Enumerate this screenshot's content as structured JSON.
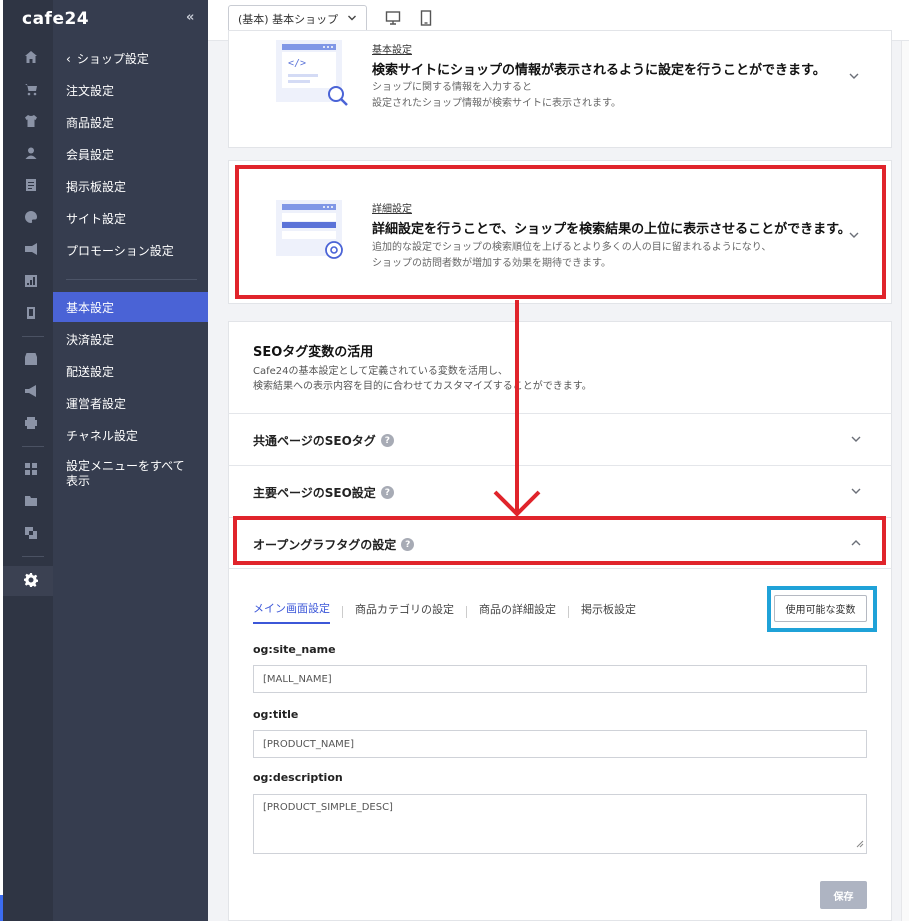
{
  "brand": {
    "logo": "cafe24",
    "collapse_glyph": "«"
  },
  "rail_icons": [
    "home-icon",
    "cart-icon",
    "shirt-icon",
    "user-icon",
    "board-icon",
    "palette-icon",
    "promo-icon",
    "chart-icon",
    "mobile-icon",
    "store-icon",
    "megaphone-icon",
    "printer-icon",
    "apps-icon",
    "folder-add-icon",
    "copy-icon",
    "gear-icon"
  ],
  "menu": {
    "back_label": "ショップ設定",
    "items": [
      "注文設定",
      "商品設定",
      "会員設定",
      "掲示板設定",
      "サイト設定",
      "プロモーション設定"
    ],
    "items2": [
      "基本設定",
      "決済設定",
      "配送設定",
      "運営者設定",
      "チャネル設定"
    ],
    "all_menu_line1": "設定メニューをすべて",
    "all_menu_line2": "表示"
  },
  "topbar": {
    "shop_select": "(基本) 基本ショップ",
    "devices": [
      "desktop-icon",
      "mobile-icon"
    ]
  },
  "card1": {
    "tag": "基本設定",
    "title": "検索サイトにショップの情報が表示されるように設定を行うことができます。",
    "desc1": "ショップに関する情報を入力すると",
    "desc2": "設定されたショップ情報が検索サイトに表示されます。"
  },
  "card2": {
    "tag": "詳細設定",
    "title": "詳細設定を行うことで、ショップを検索結果の上位に表示させることができます。",
    "desc1": "追加的な設定でショップの検索順位を上げるとより多くの人の目に留まれるようになり、",
    "desc2": "ショップの訪問者数が増加する効果を期待できます。"
  },
  "seo": {
    "title": "SEOタグ変数の活用",
    "desc1": "Cafe24の基本設定として定義されている変数を活用し、",
    "desc2": "検索結果への表示内容を目的に合わせてカスタマイズすることができます。",
    "rows": [
      "共通ページのSEOタグ",
      "主要ページのSEO設定",
      "オープングラフタグの設定"
    ],
    "help_glyph": "?"
  },
  "og": {
    "tabs": [
      "メイン画面設定",
      "商品カテゴリの設定",
      "商品の詳細設定",
      "掲示板設定"
    ],
    "vars_button": "使用可能な変数",
    "fields": [
      {
        "label": "og:site_name",
        "value": "[MALL_NAME]"
      },
      {
        "label": "og:title",
        "value": "[PRODUCT_NAME]"
      },
      {
        "label": "og:description",
        "value": "[PRODUCT_SIMPLE_DESC]"
      }
    ],
    "save_button": "保存"
  },
  "colors": {
    "highlight_red": "#e0242b",
    "highlight_blue": "#1fa2d8",
    "accent": "#4a63d6"
  }
}
